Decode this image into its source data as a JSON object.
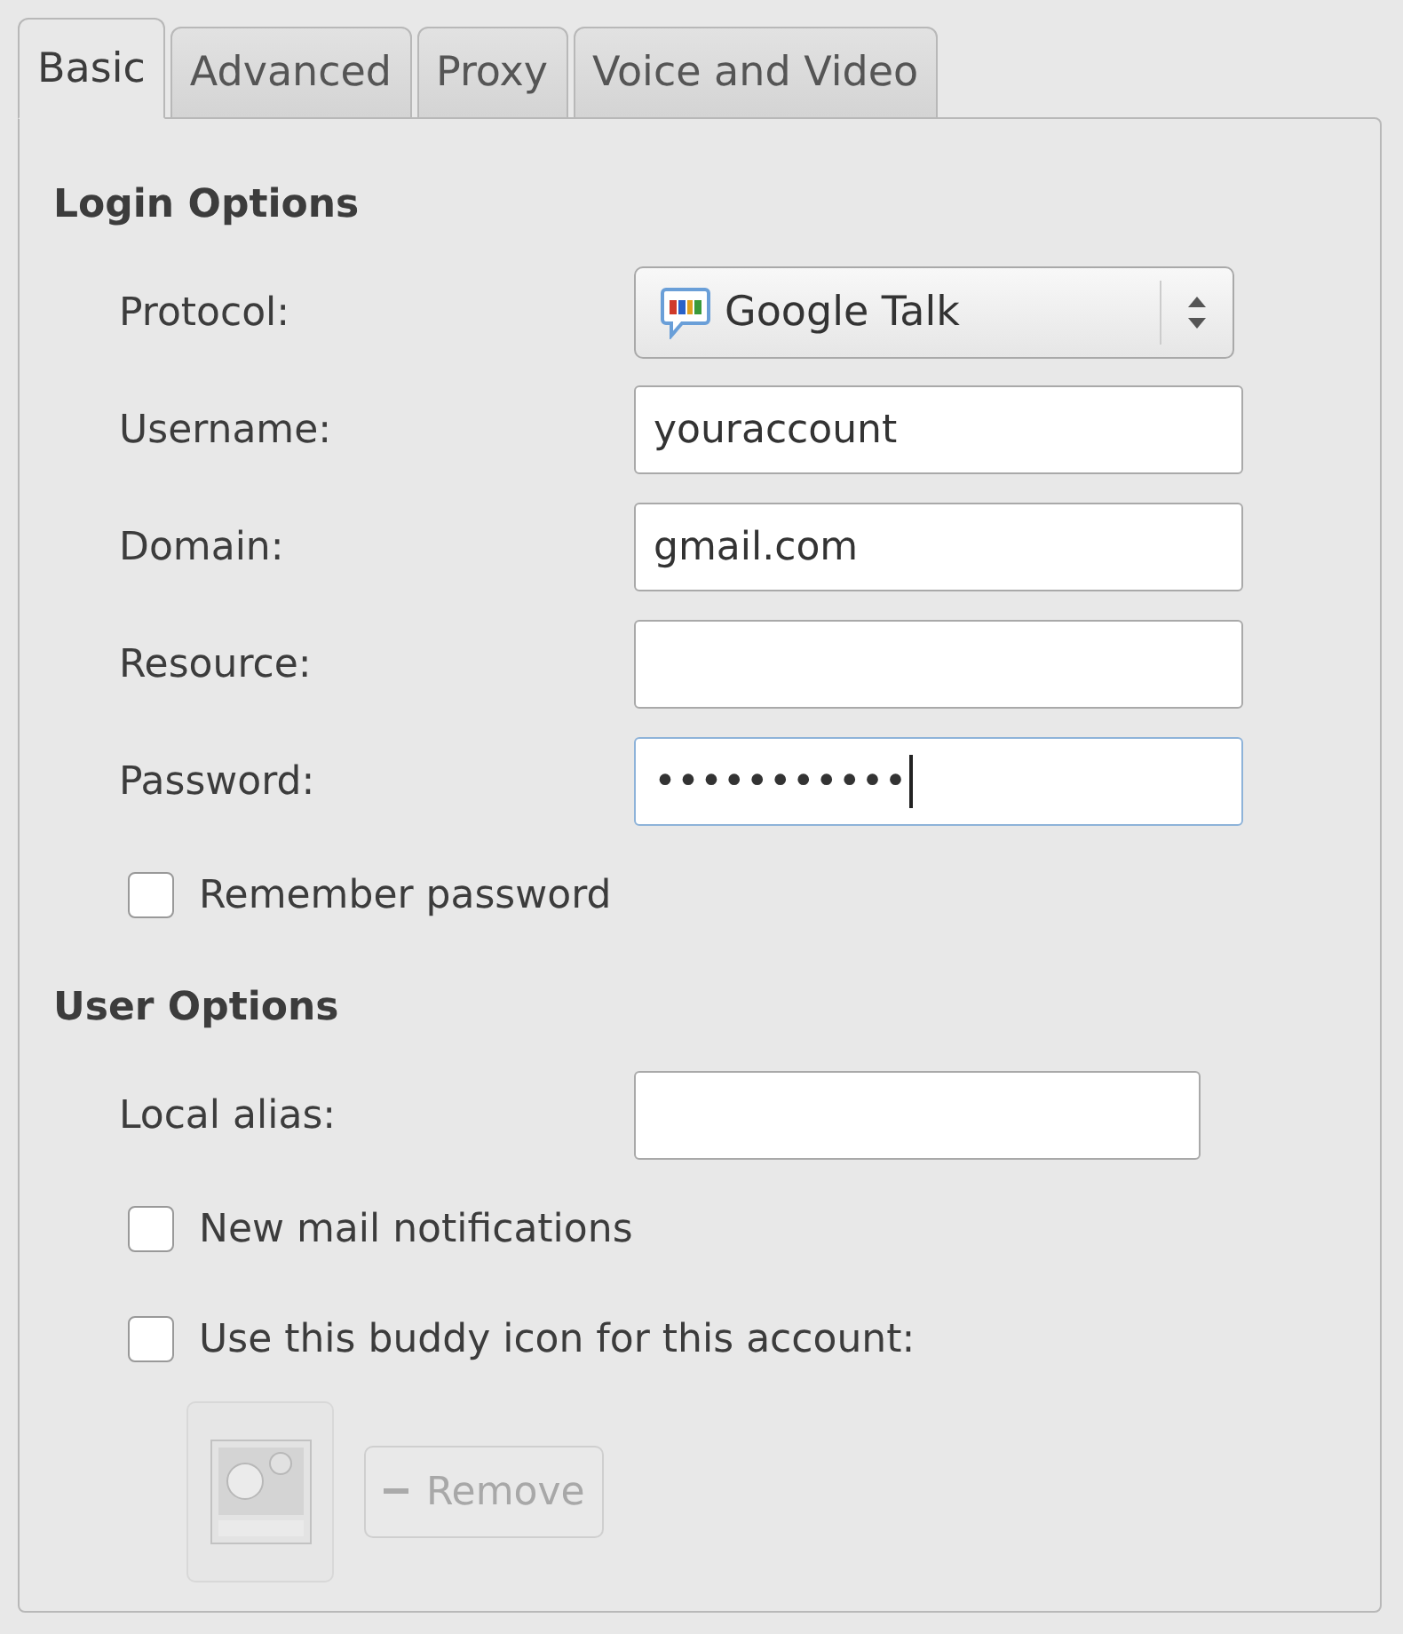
{
  "tabs": [
    {
      "label": "Basic",
      "selected": true
    },
    {
      "label": "Advanced",
      "selected": false
    },
    {
      "label": "Proxy",
      "selected": false
    },
    {
      "label": "Voice and Video",
      "selected": false
    }
  ],
  "sections": [
    {
      "title": "Login Options",
      "rows": [
        {
          "kind": "select",
          "label": "Protocol:",
          "value": "Google Talk"
        },
        {
          "kind": "field",
          "label": "Username:",
          "value": "youraccount",
          "focused": false
        },
        {
          "kind": "field",
          "label": "Domain:",
          "value": "gmail.com",
          "focused": false
        },
        {
          "kind": "field",
          "label": "Resource:",
          "value": "",
          "focused": false
        },
        {
          "kind": "field",
          "label": "Password:",
          "value": "•••••••••••",
          "focused": true
        },
        {
          "kind": "checkbox",
          "label": "Remember password",
          "checked": false
        }
      ]
    },
    {
      "title": "User Options",
      "rows": [
        {
          "kind": "short-field",
          "label": "Local alias:",
          "value": "",
          "focused": false
        },
        {
          "kind": "checkbox",
          "label": "New mail notifications",
          "checked": false
        },
        {
          "kind": "checkbox",
          "label": "Use this buddy icon for this account:",
          "checked": false
        }
      ]
    }
  ],
  "buddy_icon": {
    "disabled": true,
    "remove_button": {
      "label": "Remove",
      "disabled": true
    }
  }
}
